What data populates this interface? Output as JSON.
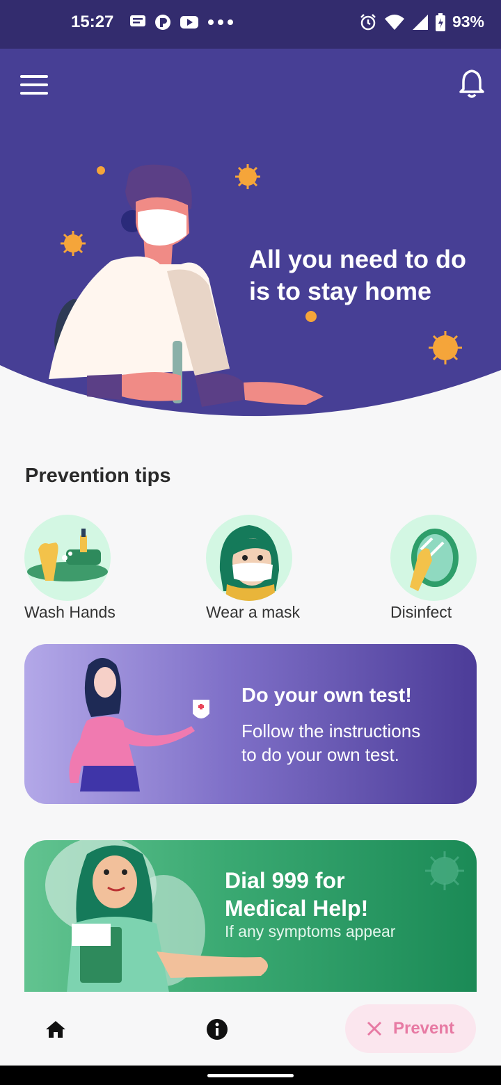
{
  "status_bar": {
    "time": "15:27",
    "battery": "93%",
    "left_icons": [
      "message-icon",
      "p-icon",
      "youtube-icon",
      "more-dots-icon"
    ],
    "right_icons": [
      "alarm-icon",
      "wifi-icon",
      "signal-icon",
      "battery-icon"
    ]
  },
  "header": {
    "menu_icon": "hamburger-icon",
    "notification_icon": "bell-icon",
    "hero_text_line1": "All you need to do",
    "hero_text_line2": "is to stay  home"
  },
  "prevention": {
    "title": "Prevention tips",
    "tips": [
      {
        "label": "Wash Hands"
      },
      {
        "label": "Wear a mask"
      },
      {
        "label": "Disinfect"
      }
    ]
  },
  "cards": {
    "test": {
      "title": "Do your own test!",
      "line1": "Follow the instructions",
      "line2": "to do your own test."
    },
    "dial": {
      "title_line1": "Dial 999 for",
      "title_line2": "Medical Help!",
      "subtitle": "If any symptoms appear"
    }
  },
  "bottom_nav": {
    "home_icon": "home-icon",
    "info_icon": "info-icon",
    "prevent_label": "Prevent"
  },
  "colors": {
    "header_purple": "#473f95",
    "status_purple": "#332c6e",
    "accent_pink": "#e77aa3",
    "tip_bg": "#d3f7e3"
  }
}
